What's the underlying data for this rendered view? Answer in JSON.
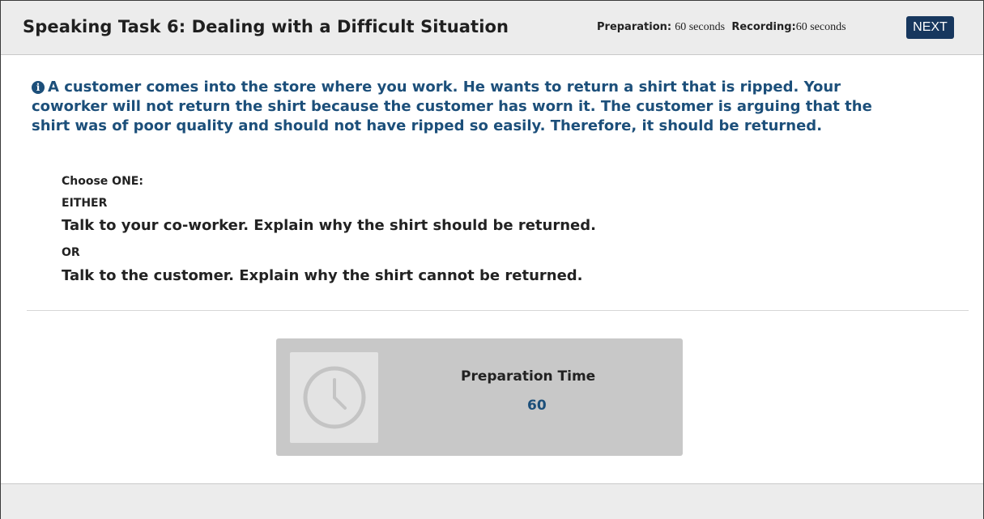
{
  "header": {
    "title": "Speaking Task 6: Dealing with a Difficult Situation",
    "preparation_label": "Preparation:",
    "preparation_value": "60 seconds",
    "recording_label": "Recording:",
    "recording_value": "60 seconds",
    "next_label": "NEXT"
  },
  "prompt": {
    "icon": "info-icon",
    "text": "A customer comes into the store where you work. He wants to return a shirt that is ripped. Your coworker will not return the shirt because the customer has worn it. The customer is arguing that the shirt was of poor quality and should not have ripped so easily. Therefore, it should be returned."
  },
  "choices": {
    "choose_label": "Choose ONE:",
    "either_label": "EITHER",
    "option1": "Talk to your co-worker.  Explain why the shirt should be returned.",
    "or_label": "OR",
    "option2": "Talk to the customer.  Explain why the shirt cannot be returned."
  },
  "timer": {
    "icon": "clock-icon",
    "label": "Preparation Time",
    "value": "60"
  },
  "colors": {
    "accent": "#17375e",
    "prompt_text": "#1c4f7a",
    "header_bg": "#ececec",
    "timer_bg": "#c8c8c8"
  }
}
